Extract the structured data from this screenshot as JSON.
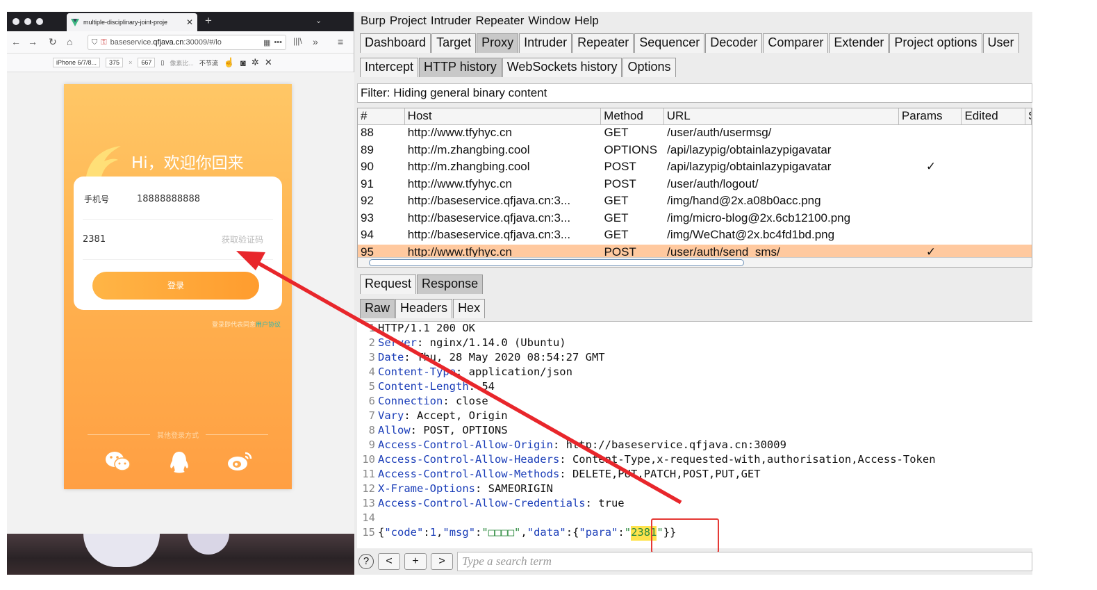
{
  "firefox": {
    "tab_title": "multiple-disciplinary-joint-proje",
    "url_prefix": "baseservice.",
    "url_domain": "qfjava.cn",
    "url_suffix": ":30009/#/lo",
    "rdm": {
      "device": "iPhone 6/7/8...",
      "width": "375",
      "times": "×",
      "height": "667",
      "dpr": "像素比...",
      "throttle": "不节流"
    }
  },
  "phone": {
    "greeting": "Hi，欢迎你回来",
    "phone_label": "手机号",
    "phone_value": "18888888888",
    "code_value": "2381",
    "get_code": "获取验证码",
    "login": "登录",
    "agree_prefix": "登录即代表同意",
    "agree_link": "用户协议",
    "other_login": "其他登录方式"
  },
  "burp": {
    "menu": [
      "Burp",
      "Project",
      "Intruder",
      "Repeater",
      "Window",
      "Help"
    ],
    "main_tabs": [
      "Dashboard",
      "Target",
      "Proxy",
      "Intruder",
      "Repeater",
      "Sequencer",
      "Decoder",
      "Comparer",
      "Extender",
      "Project options",
      "User"
    ],
    "main_active": "Proxy",
    "proxy_tabs": [
      "Intercept",
      "HTTP history",
      "WebSockets history",
      "Options"
    ],
    "proxy_active": "HTTP history",
    "filter": "Filter: Hiding general binary content",
    "columns": [
      "#",
      "Host",
      "Method",
      "URL",
      "Params",
      "Edited",
      "S"
    ],
    "rows": [
      {
        "num": "88",
        "host": "http://www.tfyhyc.cn",
        "method": "GET",
        "url": "/user/auth/usermsg/",
        "params": "",
        "selected": false
      },
      {
        "num": "89",
        "host": "http://m.zhangbing.cool",
        "method": "OPTIONS",
        "url": "/api/lazypig/obtainlazypigavatar",
        "params": "",
        "selected": false
      },
      {
        "num": "90",
        "host": "http://m.zhangbing.cool",
        "method": "POST",
        "url": "/api/lazypig/obtainlazypigavatar",
        "params": "✓",
        "selected": false
      },
      {
        "num": "91",
        "host": "http://www.tfyhyc.cn",
        "method": "POST",
        "url": "/user/auth/logout/",
        "params": "",
        "selected": false
      },
      {
        "num": "92",
        "host": "http://baseservice.qfjava.cn:3...",
        "method": "GET",
        "url": "/img/hand@2x.a08b0acc.png",
        "params": "",
        "selected": false
      },
      {
        "num": "93",
        "host": "http://baseservice.qfjava.cn:3...",
        "method": "GET",
        "url": "/img/micro-blog@2x.6cb12100.png",
        "params": "",
        "selected": false
      },
      {
        "num": "94",
        "host": "http://baseservice.qfjava.cn:3...",
        "method": "GET",
        "url": "/img/WeChat@2x.bc4fd1bd.png",
        "params": "",
        "selected": false
      },
      {
        "num": "95",
        "host": "http://www.tfyhyc.cn",
        "method": "POST",
        "url": "/user/auth/send_sms/",
        "params": "✓",
        "selected": true
      }
    ],
    "msg_tabs": [
      "Request",
      "Response"
    ],
    "msg_active": "Response",
    "view_tabs": [
      "Raw",
      "Headers",
      "Hex"
    ],
    "view_active": "Raw",
    "response_lines": [
      {
        "n": "1",
        "key": "",
        "rest": "HTTP/1.1 200 OK"
      },
      {
        "n": "2",
        "key": "Server",
        "rest": ": nginx/1.14.0 (Ubuntu)"
      },
      {
        "n": "3",
        "key": "Date",
        "rest": ": Thu, 28 May 2020 08:54:27 GMT"
      },
      {
        "n": "4",
        "key": "Content-Type",
        "rest": ": application/json"
      },
      {
        "n": "5",
        "key": "Content-Length",
        "rest": ": 54"
      },
      {
        "n": "6",
        "key": "Connection",
        "rest": ": close"
      },
      {
        "n": "7",
        "key": "Vary",
        "rest": ": Accept, Origin"
      },
      {
        "n": "8",
        "key": "Allow",
        "rest": ": POST, OPTIONS"
      },
      {
        "n": "9",
        "key": "Access-Control-Allow-Origin",
        "rest": ": http://baseservice.qfjava.cn:30009"
      },
      {
        "n": "10",
        "key": "Access-Control-Allow-Headers",
        "rest": ": Content-Type,x-requested-with,authorisation,Access-Token"
      },
      {
        "n": "11",
        "key": "Access-Control-Allow-Methods",
        "rest": ": DELETE,PUT,PATCH,POST,PUT,GET"
      },
      {
        "n": "12",
        "key": "X-Frame-Options",
        "rest": ": SAMEORIGIN"
      },
      {
        "n": "13",
        "key": "Access-Control-Allow-Credentials",
        "rest": ": true"
      },
      {
        "n": "14",
        "key": "",
        "rest": ""
      }
    ],
    "json_line": {
      "n": "15",
      "open": "{",
      "k1": "\"code\"",
      "colon1": ":",
      "v1": "1",
      "comma1": ",",
      "k2": "\"msg\"",
      "colon2": ":",
      "v2": "\"□□□□\"",
      "comma2": ",",
      "k3": "\"data\"",
      "colon3": ":{",
      "k4": "\"para\"",
      "colon4": ":",
      "q1": "\"",
      "v4": "2381",
      "q2": "\"",
      "close": "}}"
    },
    "search_placeholder": "Type a search term",
    "nav_buttons": [
      "<",
      "+",
      ">"
    ],
    "help": "?"
  },
  "colors": {
    "phone_orange": "#ffb350",
    "selected_row": "#ffc99f",
    "arrow_red": "#e8262b",
    "highlight": "#ffe34d"
  }
}
